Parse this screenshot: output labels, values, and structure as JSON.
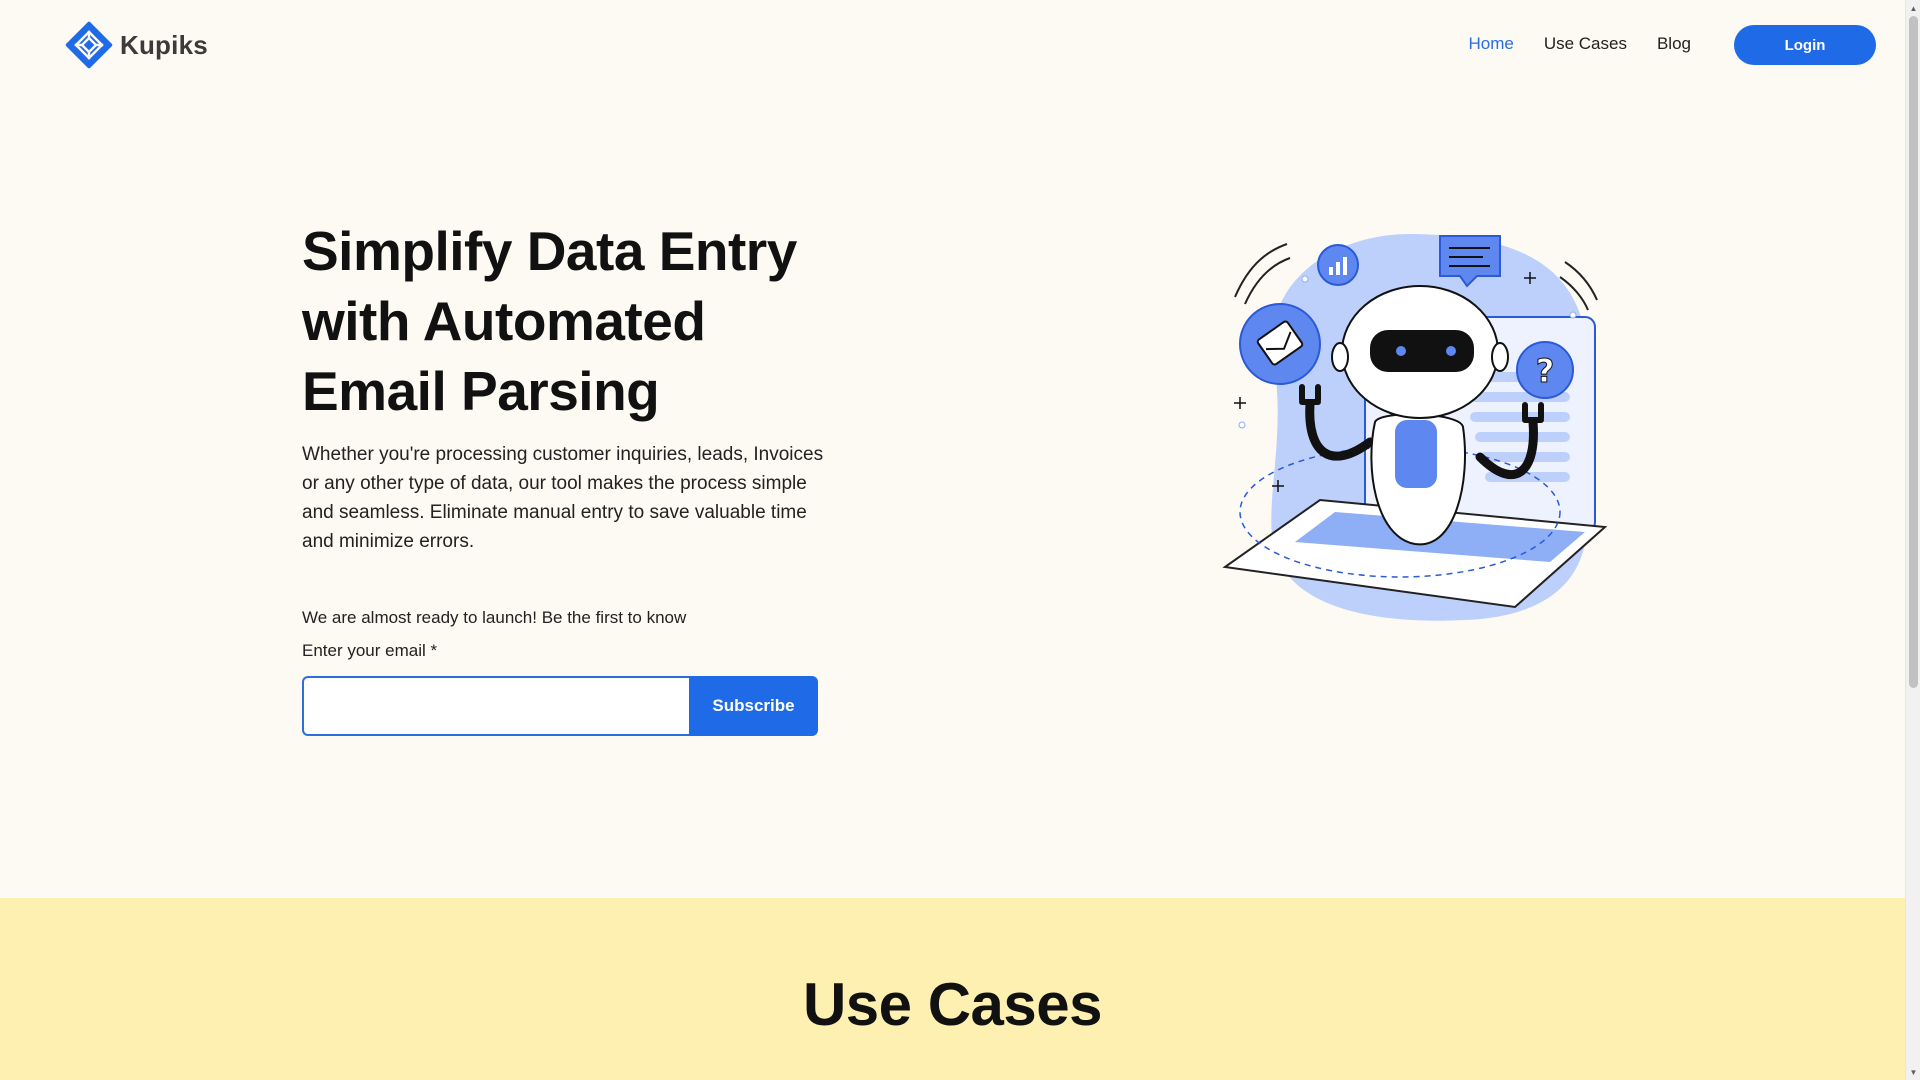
{
  "header": {
    "logo_text": "Kupiks",
    "nav": [
      {
        "label": "Home",
        "active": true
      },
      {
        "label": "Use Cases",
        "active": false
      },
      {
        "label": "Blog",
        "active": false
      }
    ],
    "login_label": "Login"
  },
  "hero": {
    "title_line1": "Simplify Data Entry",
    "title_line2": "with Automated",
    "title_line3": "Email Parsing",
    "description": "Whether you're processing customer inquiries, leads, Invoices or any other type of data, our tool makes the process simple and seamless.  Eliminate manual entry to save valuable time and minimize errors.",
    "launch_text": "We are almost ready to launch! Be the first to know",
    "email_label": "Enter your email *",
    "email_value": "",
    "subscribe_label": "Subscribe"
  },
  "usecases": {
    "title": "Use Cases"
  },
  "colors": {
    "accent": "#1f6ae6",
    "hero_bg": "#fdf9f3",
    "usecases_bg": "#fef0b0"
  }
}
